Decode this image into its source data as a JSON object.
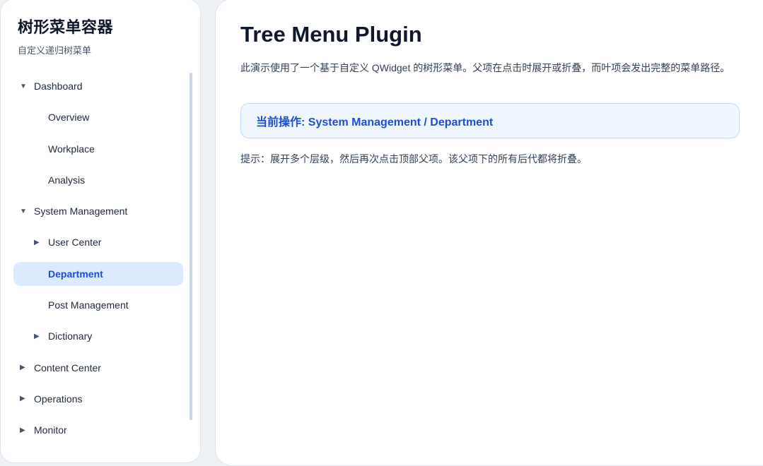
{
  "sidebar": {
    "title": "树形菜单容器",
    "subtitle": "自定义递归树菜单",
    "items": [
      {
        "label": "Dashboard",
        "level": 0,
        "arrow": "▼",
        "selected": false
      },
      {
        "label": "Overview",
        "level": 1,
        "arrow": "",
        "selected": false
      },
      {
        "label": "Workplace",
        "level": 1,
        "arrow": "",
        "selected": false
      },
      {
        "label": "Analysis",
        "level": 1,
        "arrow": "",
        "selected": false
      },
      {
        "label": "System Management",
        "level": 0,
        "arrow": "▼",
        "selected": false
      },
      {
        "label": "User Center",
        "level": 1,
        "arrow": "▶",
        "selected": false
      },
      {
        "label": "Department",
        "level": 1,
        "arrow": "",
        "selected": true
      },
      {
        "label": "Post Management",
        "level": 1,
        "arrow": "",
        "selected": false
      },
      {
        "label": "Dictionary",
        "level": 1,
        "arrow": "▶",
        "selected": false
      },
      {
        "label": "Content Center",
        "level": 0,
        "arrow": "▶",
        "selected": false
      },
      {
        "label": "Operations",
        "level": 0,
        "arrow": "▶",
        "selected": false
      },
      {
        "label": "Monitor",
        "level": 0,
        "arrow": "▶",
        "selected": false
      }
    ]
  },
  "main": {
    "title": "Tree Menu Plugin",
    "description": "此演示使用了一个基于自定义 QWidget 的树形菜单。父项在点击时展开或折叠，而叶项会发出完整的菜单路径。",
    "current_action": "当前操作: System Management / Department",
    "hint": "提示：展开多个层级，然后再次点击顶部父项。该父项下的所有后代都将折叠。"
  },
  "colors": {
    "accent": "#1d4ed8",
    "selected_bg": "#dbeafe",
    "action_bg": "#eff6ff"
  }
}
